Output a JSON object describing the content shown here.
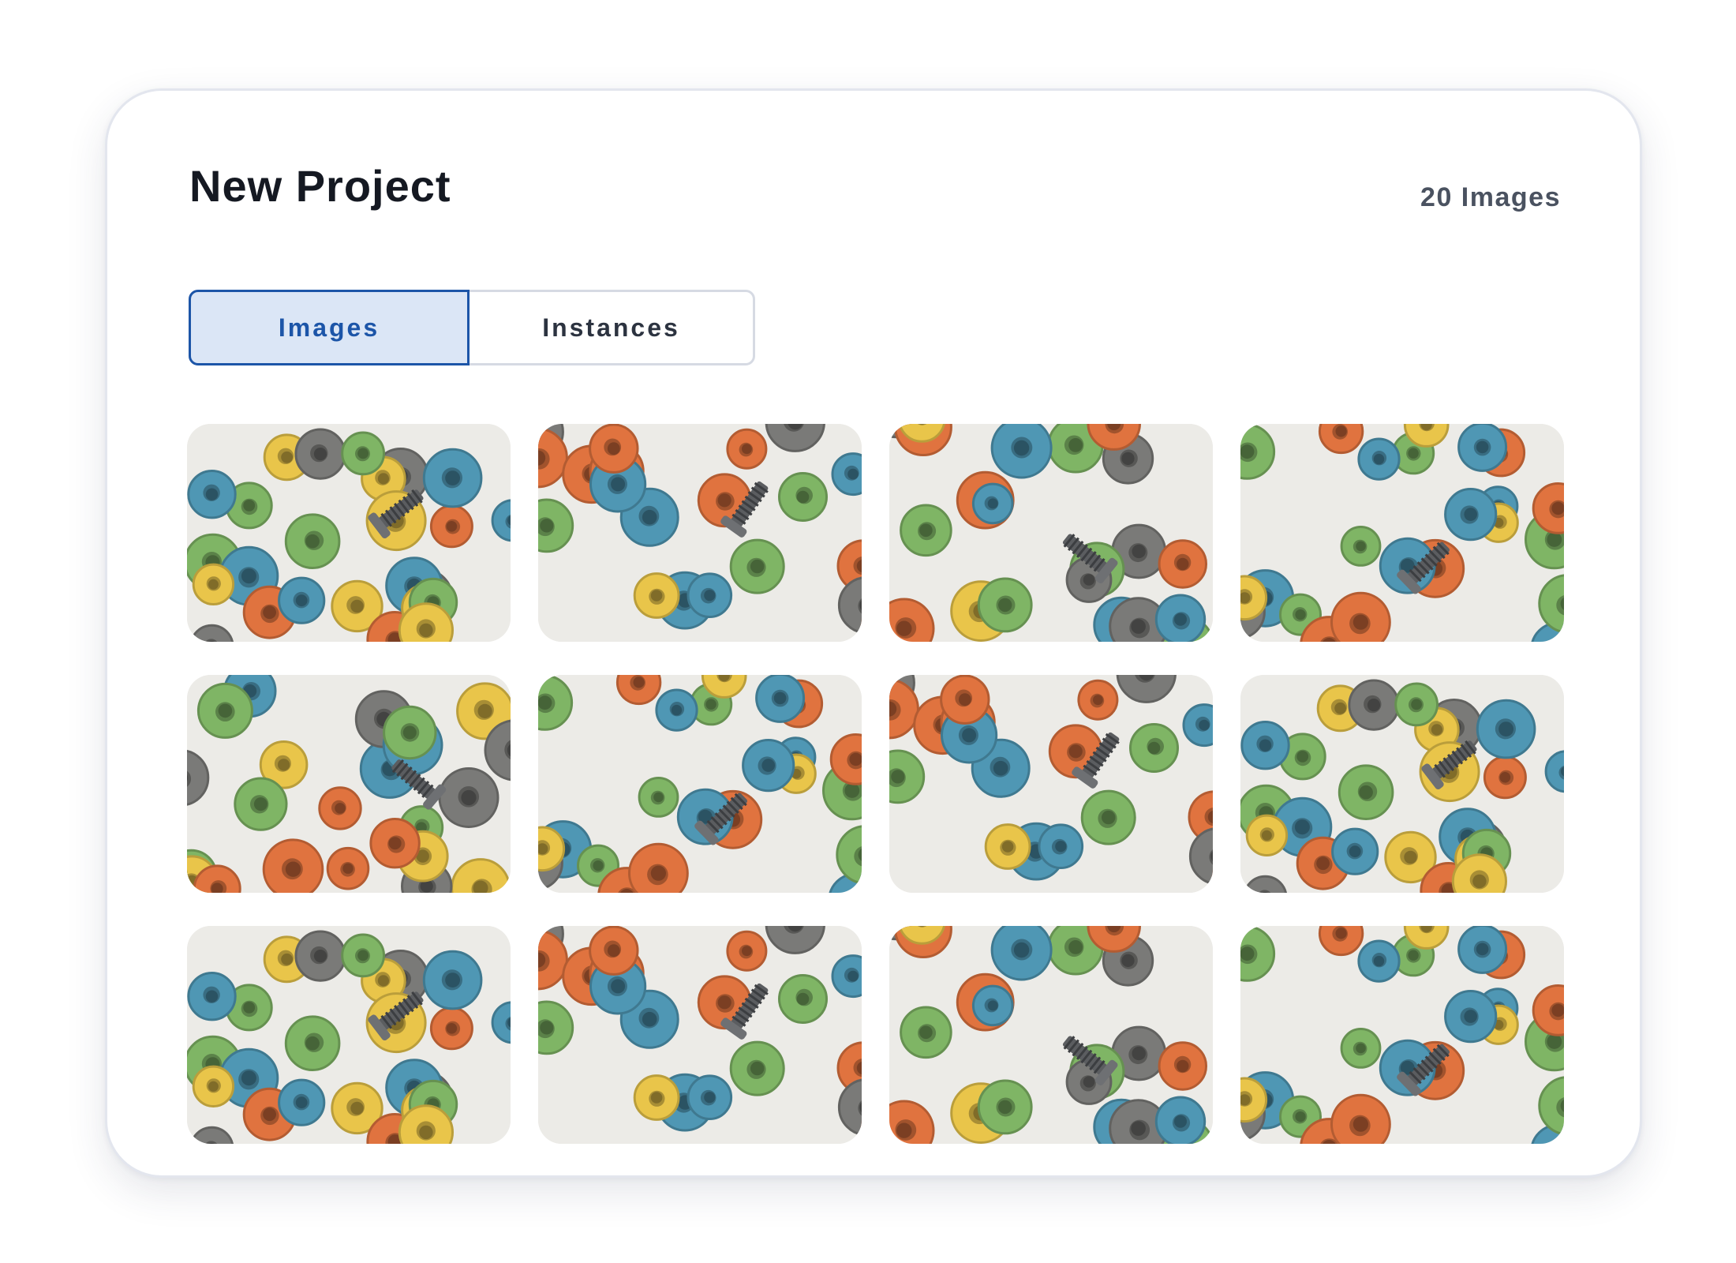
{
  "project": {
    "title": "New Project",
    "image_count": "20 Images"
  },
  "tabs": [
    {
      "label": "Images",
      "active": true
    },
    {
      "label": "Instances",
      "active": false
    }
  ],
  "colors": {
    "accent": "#1c55a8",
    "accent_bg": "#dbe6f6",
    "cereal": [
      "#e0733f",
      "#e9c54a",
      "#7fb565",
      "#4f97b4",
      "#7a7a78"
    ]
  },
  "thumbnails": [
    {
      "icon": "cereal-screws-photo",
      "variant": 0
    },
    {
      "icon": "cereal-screws-photo",
      "variant": 1
    },
    {
      "icon": "cereal-screws-photo",
      "variant": 2
    },
    {
      "icon": "cereal-screws-photo",
      "variant": 3
    },
    {
      "icon": "cereal-screws-photo",
      "variant": 4
    },
    {
      "icon": "cereal-screws-photo",
      "variant": 3
    },
    {
      "icon": "cereal-screws-photo",
      "variant": 1
    },
    {
      "icon": "cereal-screws-photo",
      "variant": 0
    },
    {
      "icon": "cereal-screws-photo",
      "variant": 0
    },
    {
      "icon": "cereal-screws-photo",
      "variant": 1
    },
    {
      "icon": "cereal-screws-photo",
      "variant": 2
    },
    {
      "icon": "cereal-screws-photo",
      "variant": 3
    }
  ]
}
